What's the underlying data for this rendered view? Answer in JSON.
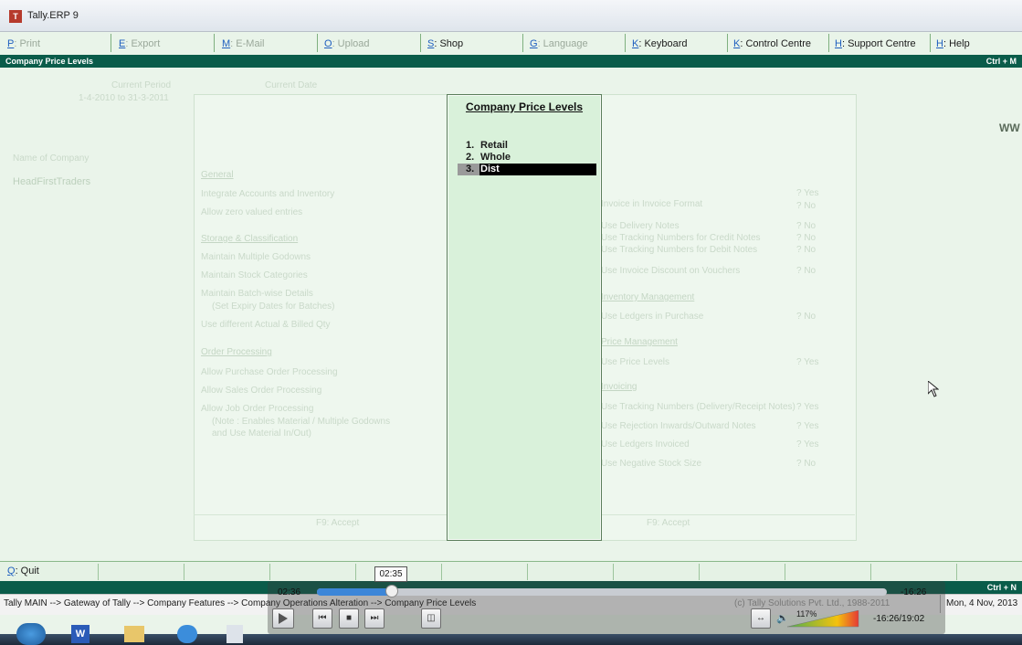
{
  "window": {
    "title": "Tally.ERP 9",
    "icon_text": "T"
  },
  "top_menu": [
    {
      "key": "P",
      "label": ": Print",
      "enabled": false
    },
    {
      "key": "E",
      "label": ": Export",
      "enabled": false
    },
    {
      "key": "M",
      "label": ": E-Mail",
      "enabled": false
    },
    {
      "key": "O",
      "label": ": Upload",
      "enabled": false
    },
    {
      "key": "S",
      "label": ": Shop",
      "enabled": true
    },
    {
      "key": "G",
      "label": ": Language",
      "enabled": false
    },
    {
      "key": "K",
      "label": ": Keyboard",
      "enabled": true
    },
    {
      "key": "K",
      "label": ": Control Centre",
      "enabled": true
    },
    {
      "key": "H",
      "label": ": Support Centre",
      "enabled": true
    },
    {
      "key": "H",
      "label": ": Help",
      "enabled": true
    }
  ],
  "header_bar": {
    "title": "Company Price Levels",
    "shortcut": "Ctrl + M"
  },
  "background": {
    "current_period_label": "Current Period",
    "current_period": "1-4-2010 to 31-3-2011",
    "current_date_label": "Current Date",
    "name_of_company_label": "Name of Company",
    "company_name": "HeadFirstTraders",
    "right_edge_text": "WW",
    "sections": {
      "general": "General",
      "integrate": "Integrate Accounts and Inventory",
      "allow_zero": "Allow zero valued entries",
      "storage": "Storage & Classification",
      "multiple_godowns": "Maintain Multiple Godowns",
      "stock_categories": "Maintain Stock Categories",
      "batch_wise": "Maintain Batch-wise Details",
      "set_expiry": "(Set Expiry Dates for Batches)",
      "actual_billed": "Use different Actual & Billed Qty",
      "order_processing": "Order Processing",
      "purchase_order": "Allow Purchase Order Processing",
      "sales_order": "Allow Sales Order Processing",
      "job_order": "Allow Job Order Processing",
      "job_note1": "(Note : Enables Material / Multiple Godowns",
      "job_note2": "and Use Material In/Out)",
      "accept": "F9: Accept",
      "accept2": "F9: Accept"
    },
    "right_column": [
      {
        "label": "Use Invoice",
        "value": "? Yes"
      },
      {
        "label": "Invoice in Invoice Format",
        "value": "? No"
      },
      {
        "label": "Use Delivery Notes",
        "value": "? No"
      },
      {
        "label": "Use Tracking Numbers for Credit Notes",
        "value": "? No"
      },
      {
        "label": "Use Tracking Numbers for Debit Notes",
        "value": "? No"
      },
      {
        "label": "Use Invoice Discount on Vouchers",
        "value": "? No"
      },
      {
        "label": "Inventory Management",
        "value": ""
      },
      {
        "label": "Use Ledgers in Purchase",
        "value": "? No"
      },
      {
        "label": "Price Management",
        "value": ""
      },
      {
        "label": "Use Price Levels",
        "value": "? Yes"
      },
      {
        "label": "Invoicing",
        "value": ""
      },
      {
        "label": "Use Tracking Numbers (Delivery/Receipt Notes)",
        "value": "? Yes"
      },
      {
        "label": "Use Rejection Inwards/Outward Notes",
        "value": "? Yes"
      },
      {
        "label": "Use Ledgers Invoiced",
        "value": "? Yes"
      },
      {
        "label": "Use Negative Stock Size",
        "value": "? No"
      }
    ]
  },
  "popup": {
    "title": "Company Price Levels",
    "items": [
      {
        "num": "1.",
        "label": "Retail"
      },
      {
        "num": "2.",
        "label": "Whole"
      },
      {
        "num": "3.",
        "label": "Dist"
      }
    ],
    "selected_index": 2
  },
  "quit_bar": {
    "key": "Q",
    "label": ": Quit"
  },
  "status_bar": {
    "shortcut": "Ctrl + N"
  },
  "path_bar": {
    "path": "Tally MAIN --> Gateway of Tally --> Company Features --> Company Operations Alteration --> Company Price Levels",
    "copyright": "(c) Tally Solutions Pvt. Ltd., 1988-2011",
    "date": "Mon, 4 Nov, 2013"
  },
  "player": {
    "elapsed": "02:36",
    "hover_time": "02:35",
    "remaining": "-16:26",
    "remaining_total": "-16:26/19:02",
    "zoom": "117%",
    "progress_fraction": 0.13
  }
}
